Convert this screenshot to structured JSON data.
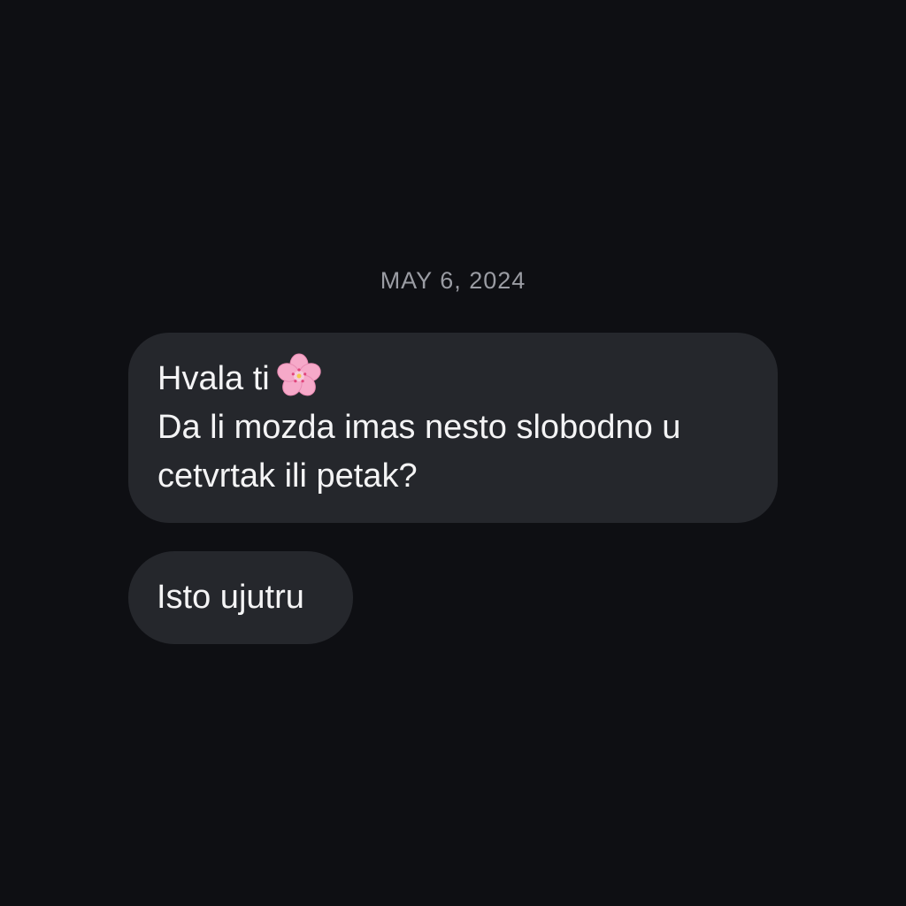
{
  "conversation": {
    "date_divider": "MAY 6, 2024",
    "messages": [
      {
        "lines": [
          "Hvala ti",
          "Da li mozda imas nesto slobodno u",
          "cetvrtak ili petak?"
        ],
        "emoji": "cherry-blossom-icon"
      },
      {
        "lines": [
          "Isto ujutru"
        ]
      }
    ]
  },
  "colors": {
    "background": "#0e0f13",
    "bubble": "#25272c",
    "text": "#f4f4f5",
    "date_text": "#9a9ca3"
  }
}
